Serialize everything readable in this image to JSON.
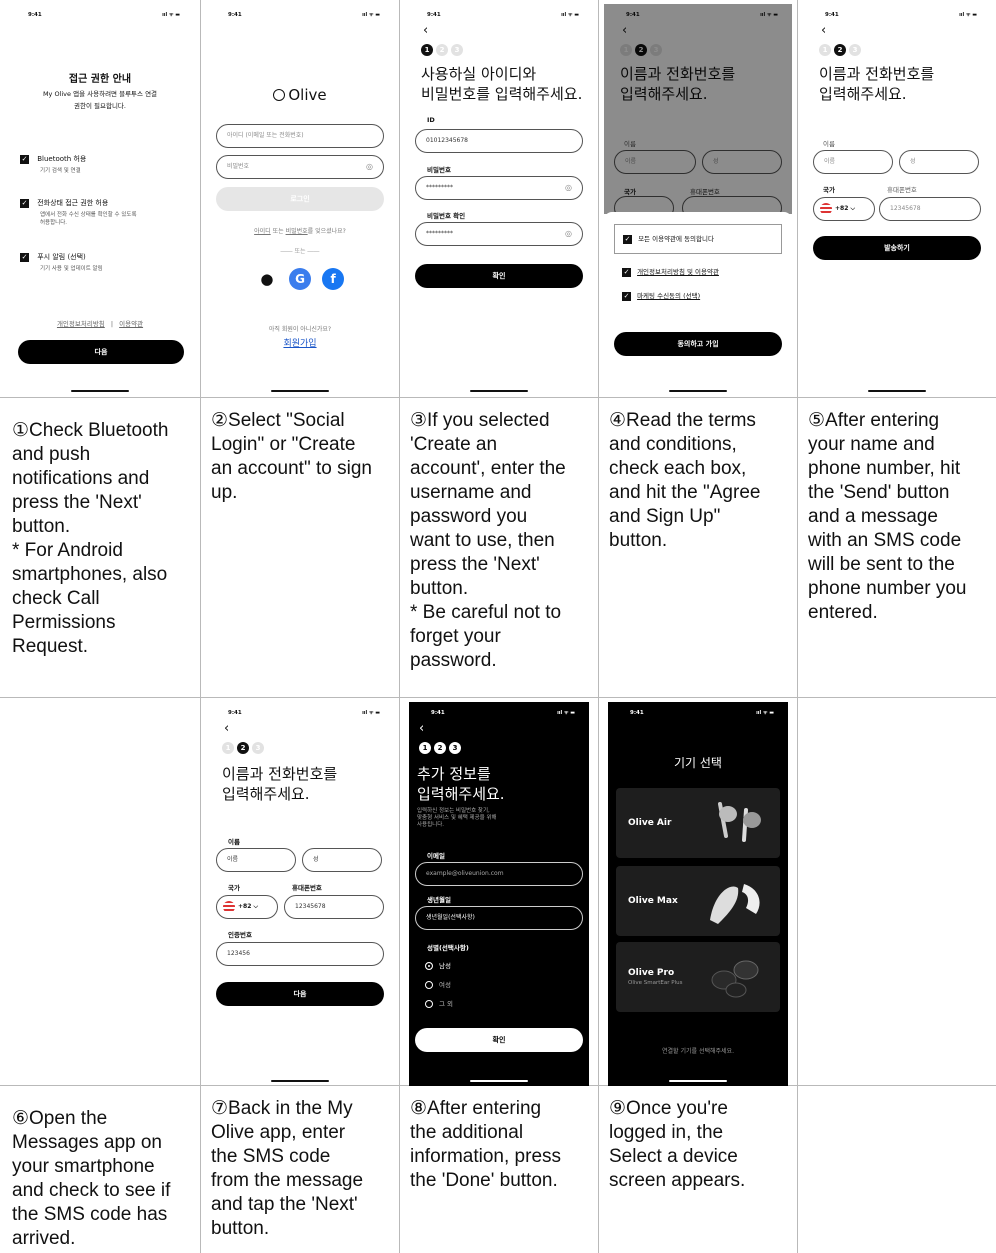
{
  "captions": {
    "c1": "①Check Bluetooth\nand push\nnotifications and\npress the 'Next'\nbutton.\n* For Android\nsmartphones, also\ncheck Call\nPermissions\nRequest.",
    "c2": "②Select \"Social\nLogin\" or \"Create\nan account\" to sign\nup.",
    "c3": "③If you selected\n'Create an\naccount', enter the\nusername and\npassword you\nwant to use, then\npress the 'Next'\nbutton.\n* Be careful not to\nforget your\npassword.",
    "c4": "④Read the terms\nand conditions,\ncheck each box,\nand hit the \"Agree\nand Sign Up\"\nbutton.",
    "c5": "⑤After entering\nyour name and\nphone number, hit\nthe 'Send' button\nand a message\nwith an SMS code\nwill be sent to the\nphone number you\nentered.",
    "c6": "⑥Open the\nMessages app on\nyour smartphone\nand check to see if\nthe SMS code has\narrived.",
    "c7": "⑦Back in the My\nOlive app, enter\nthe SMS code\nfrom the message\nand tap the 'Next'\nbutton.",
    "c8": "⑧After entering\nthe additional\ninformation, press\nthe 'Done' button.",
    "c9": "⑨Once you're\nlogged in, the\nSelect a device\nscreen appears."
  },
  "status": {
    "time": "9:41",
    "icons": "ııl ᯤ ▬"
  },
  "s1": {
    "title": "접근 권한 안내",
    "desc": "My Olive 앱을 사용하려면 블루투스 연결\n권한이 필요합니다.",
    "items": [
      {
        "label": "Bluetooth 허용",
        "sub": "기기 검색 및 연결"
      },
      {
        "label": "전화상태 접근 권한 허용",
        "sub": "앱에서 전화 수신 상태를 확인할 수 있도록\n허용합니다."
      },
      {
        "label": "푸시 알림 (선택)",
        "sub": "기기 사용 및 업데이트 알림"
      }
    ],
    "privacy": "개인정보처리방침",
    "terms": "이용약관",
    "next": "다음"
  },
  "s2": {
    "logo": "Olive",
    "id_ph": "아이디 (이메일 또는 전화번호)",
    "pw_ph": "비밀번호",
    "login": "로그인",
    "find_id": "아이디",
    "find_or": "또는",
    "find_pw": "비밀번호",
    "find_tail": "를 잊으셨나요?",
    "or": "또는",
    "no_account": "아직 회원이 아니신가요?",
    "signup": "회원가입"
  },
  "s3": {
    "title": "사용하실 아이디와\n비밀번호를 입력해주세요.",
    "id_label": "ID",
    "id_val": "01012345678",
    "pw_label": "비밀번호",
    "pw_val": "*********",
    "pwc_label": "비밀번호 확인",
    "pwc_val": "*********",
    "confirm": "확인"
  },
  "s4": {
    "title": "이름과 전화번호를\n입력해주세요.",
    "name_label": "이름",
    "name_ph": "이름",
    "last_ph": "성",
    "country": "국가",
    "phone": "휴대폰번호",
    "agree_all": "모든 이용약관에 동의합니다",
    "agree1": "개인정보처리방침 및 이용약관",
    "agree2": "마케팅 수신동의 (선택)",
    "button": "동의하고 가입"
  },
  "s5": {
    "title": "이름과 전화번호를\n입력해주세요.",
    "name_label": "이름",
    "name_ph": "이름",
    "last_ph": "성",
    "country": "국가",
    "phone": "휴대폰번호",
    "code": "+82",
    "phone_ph": "12345678",
    "send": "발송하기"
  },
  "s7": {
    "title": "이름과 전화번호를\n입력해주세요.",
    "name_label": "이름",
    "name_ph": "이름",
    "last_ph": "성",
    "country": "국가",
    "phone": "휴대폰번호",
    "code": "+82",
    "phone_val": "12345678",
    "sms_label": "인증번호",
    "sms_val": "123456",
    "next": "다음"
  },
  "s8": {
    "title": "추가 정보를\n입력해주세요.",
    "desc": "입력하신 정보는 비밀번호 찾기,\n맞춤형 서비스 및 혜택 제공을 위해\n사용됩니다.",
    "email_label": "이메일",
    "email_ph": "example@oliveunion.com",
    "birth_label": "생년월일",
    "birth_ph": "생년월일(선택사항)",
    "gender_label": "성별(선택사항)",
    "male": "남성",
    "female": "여성",
    "other": "그 외",
    "confirm": "확인"
  },
  "s9": {
    "title": "기기 선택",
    "d1": "Olive Air",
    "d2": "Olive Max",
    "d3": "Olive Pro",
    "d3sub": "Olive SmartEar Plus",
    "footer": "연결할 기기를 선택해주세요."
  }
}
